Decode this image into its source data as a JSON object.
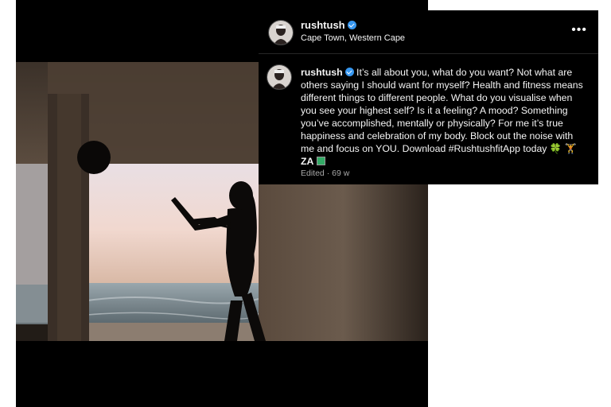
{
  "post": {
    "username": "rushtush",
    "location": "Cape Town, Western Cape",
    "more_icon": "more-horizontal-icon",
    "caption_text": "It’s all about you, what do you want? Not what are others saying I should want for myself? Health and fitness means different things to different people. What do you visualise when you see your highest self? Is it a feeling? A mood? Something you’ve accomplished, mentally or physically? For me it’s true happiness and celebration of my body. Block out the noise with me and focus on YOU. Download #RushtushfitApp today",
    "caption_emojis": "🍀 🏋",
    "caption_tail": "ZA",
    "edited_label": "Edited · 69 w",
    "verified_icon": "verified-badge-icon"
  }
}
